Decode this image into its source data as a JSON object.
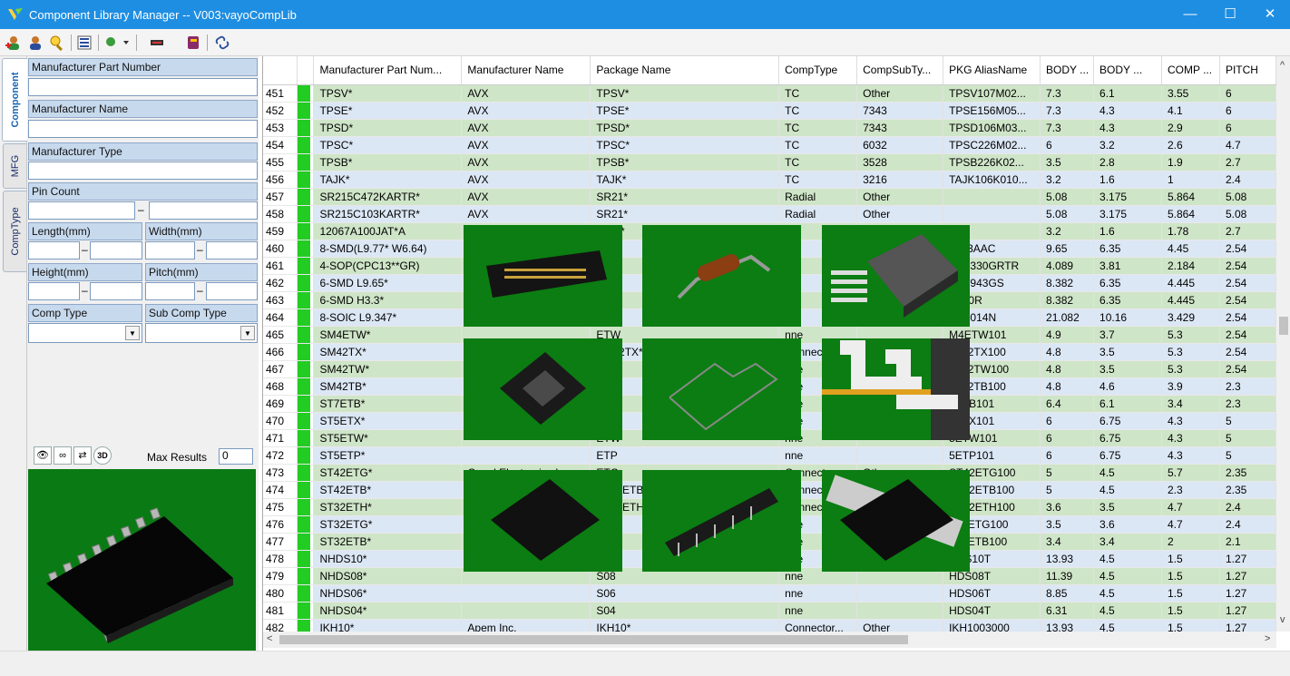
{
  "window": {
    "title": "Component Library Manager  -- V003:vayoCompLib",
    "controls": {
      "minimize": "—",
      "maximize": "☐",
      "close": "✕"
    }
  },
  "toolbar": {
    "icons": [
      "add-user-icon",
      "user-icon",
      "search-icon",
      "filter-icon",
      "find-dropdown-icon",
      "cable-icon",
      "book-icon",
      "link-icon"
    ]
  },
  "side_tabs": [
    "Component",
    "MFG",
    "CompType"
  ],
  "filter": {
    "mpn_label": "Manufacturer Part Number",
    "mname_label": "Manufacturer Name",
    "mtype_label": "Manufacturer Type",
    "pincount_label": "Pin Count",
    "length_label": "Length(mm)",
    "width_label": "Width(mm)",
    "height_label": "Height(mm)",
    "pitch_label": "Pitch(mm)",
    "comptype_label": "Comp Type",
    "subcomptype_label": "Sub Comp Type",
    "dash": "–"
  },
  "preview_toolbar": {
    "max_label": "Max Results",
    "max_value": "0",
    "btn_3d": "3D"
  },
  "grid": {
    "headers": [
      "Manufacturer Part Num...",
      "Manufacturer Name",
      "Package Name",
      "CompType",
      "CompSubTy...",
      "PKG AliasName",
      "BODY ...",
      "BODY ...",
      "COMP ...",
      "PITCH"
    ],
    "rows": [
      {
        "n": "451",
        "s": "g",
        "c": [
          "TPSV*",
          "AVX",
          "TPSV*",
          "TC",
          "Other",
          "TPSV107M02...",
          "7.3",
          "6.1",
          "3.55",
          "6"
        ]
      },
      {
        "n": "452",
        "s": "b",
        "c": [
          "TPSE*",
          "AVX",
          "TPSE*",
          "TC",
          "7343",
          "TPSE156M05...",
          "7.3",
          "4.3",
          "4.1",
          "6"
        ]
      },
      {
        "n": "453",
        "s": "g",
        "c": [
          "TPSD*",
          "AVX",
          "TPSD*",
          "TC",
          "7343",
          "TPSD106M03...",
          "7.3",
          "4.3",
          "2.9",
          "6"
        ]
      },
      {
        "n": "454",
        "s": "b",
        "c": [
          "TPSC*",
          "AVX",
          "TPSC*",
          "TC",
          "6032",
          "TPSC226M02...",
          "6",
          "3.2",
          "2.6",
          "4.7"
        ]
      },
      {
        "n": "455",
        "s": "g",
        "c": [
          "TPSB*",
          "AVX",
          "TPSB*",
          "TC",
          "3528",
          "TPSB226K02...",
          "3.5",
          "2.8",
          "1.9",
          "2.7"
        ]
      },
      {
        "n": "456",
        "s": "b",
        "c": [
          "TAJK*",
          "AVX",
          "TAJK*",
          "TC",
          "3216",
          "TAJK106K010...",
          "3.2",
          "1.6",
          "1",
          "2.4"
        ]
      },
      {
        "n": "457",
        "s": "g",
        "c": [
          "SR215C472KARTR*",
          "AVX",
          "SR21*",
          "Radial",
          "Other",
          "",
          "5.08",
          "3.175",
          "5.864",
          "5.08"
        ]
      },
      {
        "n": "458",
        "s": "b",
        "c": [
          "SR215C103KARTR*",
          "AVX",
          "SR21*",
          "Radial",
          "Other",
          "",
          "5.08",
          "3.175",
          "5.864",
          "5.08"
        ]
      },
      {
        "n": "459",
        "s": "g",
        "c": [
          "12067A100JAT*A",
          "AVX",
          "1206*",
          "CC",
          "1206",
          "",
          "3.2",
          "1.6",
          "1.78",
          "2.7"
        ]
      },
      {
        "n": "460",
        "s": "b",
        "c": [
          "8-SMD(L9.77* W6.64)",
          "",
          "D(L",
          "P",
          "",
          "1503AAC",
          "9.65",
          "6.35",
          "4.45",
          "2.54"
        ]
      },
      {
        "n": "461",
        "s": "g",
        "c": [
          "4-SOP(CPC13**GR)",
          "",
          "P(C",
          "P",
          "",
          "PC1330GRTR",
          "4.089",
          "3.81",
          "2.184",
          "2.54"
        ]
      },
      {
        "n": "462",
        "s": "b",
        "c": [
          "6-SMD L9.65*",
          "",
          "D L",
          "P",
          "",
          "PC1943GS",
          "8.382",
          "6.35",
          "4.445",
          "2.54"
        ]
      },
      {
        "n": "463",
        "s": "g",
        "c": [
          "6-SMD H3.3*",
          "",
          "D H",
          "P",
          "",
          "A710R",
          "8.382",
          "6.35",
          "4.445",
          "2.54"
        ]
      },
      {
        "n": "464",
        "s": "b",
        "c": [
          "8-SOIC L9.347*",
          "",
          "IC L",
          "P",
          "",
          "PC2014N",
          "21.082",
          "10.16",
          "3.429",
          "2.54"
        ]
      },
      {
        "n": "465",
        "s": "g",
        "c": [
          "SM4ETW*",
          "",
          "ETW",
          "nne",
          "",
          "M4ETW101",
          "4.9",
          "3.7",
          "5.3",
          "2.54"
        ]
      },
      {
        "n": "466",
        "s": "b",
        "c": [
          "SM42TX*",
          "Copal Electronics Inc",
          "SM42TX*",
          "Connecto...",
          "Other",
          "M-42TX100",
          "4.8",
          "3.5",
          "5.3",
          "2.54"
        ]
      },
      {
        "n": "467",
        "s": "g",
        "c": [
          "SM42TW*",
          "",
          "2TW",
          "nne",
          "",
          "M-42TW100",
          "4.8",
          "3.5",
          "5.3",
          "2.54"
        ]
      },
      {
        "n": "468",
        "s": "b",
        "c": [
          "SM42TB*",
          "",
          "2TB",
          "nne",
          "",
          "M-42TB100",
          "4.8",
          "4.6",
          "3.9",
          "2.3"
        ]
      },
      {
        "n": "469",
        "s": "g",
        "c": [
          "ST7ETB*",
          "",
          "ETB",
          "nne",
          "",
          "7ETB101",
          "6.4",
          "6.1",
          "3.4",
          "2.3"
        ]
      },
      {
        "n": "470",
        "s": "b",
        "c": [
          "ST5ETX*",
          "",
          "ETX",
          "nne",
          "",
          "5ETX101",
          "6",
          "6.75",
          "4.3",
          "5"
        ]
      },
      {
        "n": "471",
        "s": "g",
        "c": [
          "ST5ETW*",
          "",
          "ETW",
          "nne",
          "",
          "5ETW101",
          "6",
          "6.75",
          "4.3",
          "5"
        ]
      },
      {
        "n": "472",
        "s": "b",
        "c": [
          "ST5ETP*",
          "",
          "ETP",
          "nne",
          "",
          "5ETP101",
          "6",
          "6.75",
          "4.3",
          "5"
        ]
      },
      {
        "n": "473",
        "s": "g",
        "c": [
          "ST42ETG*",
          "Copal Electronics Inc",
          "ETG",
          "Connecto...",
          "Other",
          "ST42ETG100",
          "5",
          "4.5",
          "5.7",
          "2.35"
        ]
      },
      {
        "n": "474",
        "s": "b",
        "c": [
          "ST42ETB*",
          "Copal Electronics Inc",
          "ST42ETB*",
          "Connector...",
          "Other",
          "ST42ETB100",
          "5",
          "4.5",
          "2.3",
          "2.35"
        ]
      },
      {
        "n": "475",
        "s": "g",
        "c": [
          "ST32ETH*",
          "Copal Electronics Inc",
          "ST32ETH*",
          "Connecto...",
          "Other",
          "ST32ETH100",
          "3.6",
          "3.5",
          "4.7",
          "2.4"
        ]
      },
      {
        "n": "476",
        "s": "b",
        "c": [
          "ST32ETG*",
          "",
          "ETG",
          "nne",
          "",
          "T32ETG100",
          "3.5",
          "3.6",
          "4.7",
          "2.4"
        ]
      },
      {
        "n": "477",
        "s": "g",
        "c": [
          "ST32ETB*",
          "",
          "ETB",
          "nne",
          "",
          "T32ETB100",
          "3.4",
          "3.4",
          "2",
          "2.1"
        ]
      },
      {
        "n": "478",
        "s": "b",
        "c": [
          "NHDS10*",
          "",
          "S10",
          "nne",
          "",
          "HDS10T",
          "13.93",
          "4.5",
          "1.5",
          "1.27"
        ]
      },
      {
        "n": "479",
        "s": "g",
        "c": [
          "NHDS08*",
          "",
          "S08",
          "nne",
          "",
          "HDS08T",
          "11.39",
          "4.5",
          "1.5",
          "1.27"
        ]
      },
      {
        "n": "480",
        "s": "b",
        "c": [
          "NHDS06*",
          "",
          "S06",
          "nne",
          "",
          "HDS06T",
          "8.85",
          "4.5",
          "1.5",
          "1.27"
        ]
      },
      {
        "n": "481",
        "s": "g",
        "c": [
          "NHDS04*",
          "",
          "S04",
          "nne",
          "",
          "HDS04T",
          "6.31",
          "4.5",
          "1.5",
          "1.27"
        ]
      },
      {
        "n": "482",
        "s": "b",
        "c": [
          "IKH10*",
          "Apem Inc.",
          "IKH10*",
          "Connector...",
          "Other",
          "IKH1003000",
          "13.93",
          "4.5",
          "1.5",
          "1.27"
        ]
      },
      {
        "n": "483",
        "s": "sel",
        "c": [
          "IKH08*",
          "Apem Inc.",
          "IKH08*",
          "Connector...",
          "Other",
          "IKH0803000",
          "11.39",
          "4.5",
          "1.5",
          "1.27"
        ]
      },
      {
        "n": "484",
        "s": "b",
        "c": [
          "IKH06*",
          "Apem Inc.",
          "IKH06*",
          "Connector...",
          "Other",
          "IKH0603000",
          "8.85",
          "4.5",
          "1.5",
          "1.27"
        ]
      },
      {
        "n": "485",
        "s": "g",
        "c": [
          "IKH04*",
          "Apem Inc.",
          "IKH04*",
          "Connector...",
          "Other",
          "IKH0403000",
          "6.31",
          "4.5",
          "1.5",
          "1.27"
        ]
      }
    ]
  },
  "scroll": {
    "left": "<",
    "right": ">",
    "up": "^",
    "down": "v"
  }
}
